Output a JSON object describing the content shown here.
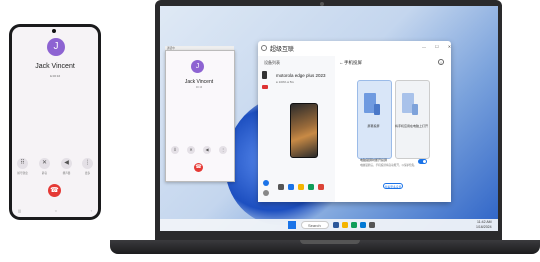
{
  "phone": {
    "avatar_letter": "J",
    "caller_name": "Jack Vincent",
    "call_status": "& 00:16",
    "controls": [
      {
        "icon": "keypad-icon",
        "glyph": "⠿",
        "label": "拨号键盘"
      },
      {
        "icon": "mute-icon",
        "glyph": "✕",
        "label": "静音"
      },
      {
        "icon": "speaker-icon",
        "glyph": "◀",
        "label": "扬声器"
      },
      {
        "icon": "more-icon",
        "glyph": "⋮",
        "label": "更多"
      }
    ],
    "end_call_glyph": "☎"
  },
  "mirror": {
    "title": "通话中",
    "avatar_letter": "J",
    "caller_name": "Jack Vincent",
    "call_status": "00:16"
  },
  "app": {
    "title": "超级互联",
    "window_controls": "—  ☐  ✕",
    "left_header": "设备列表",
    "device_name": "motorola edge plus 2023",
    "device_stats": "● 100%   ● 5G",
    "right_back": "←",
    "right_header": "手机投屏",
    "info_glyph": "i",
    "card_a_label": "屏幕投屏",
    "card_b_label": "将手机应用在电脑上打开",
    "setting_label": "电脑锁屏时断开投屏",
    "setting_desc": "电脑锁屏后，手机投屏将自动断开，以保护隐私",
    "more_button": "查看更多设置"
  },
  "taskbar": {
    "search_text": "Search",
    "time": "11:42 AM",
    "date": "1/16/2024"
  },
  "colors": {
    "accent": "#1a73e8",
    "avatar": "#8d63d2",
    "end_call": "#e53935"
  }
}
